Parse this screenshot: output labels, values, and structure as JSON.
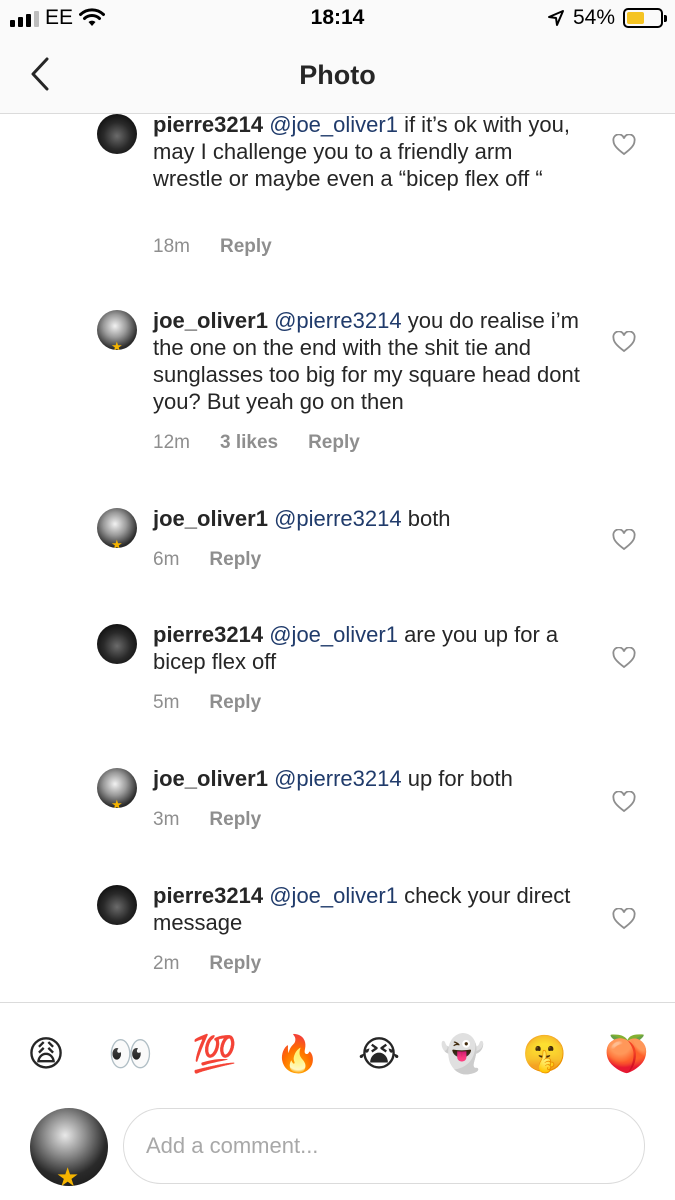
{
  "status_bar": {
    "carrier": "EE",
    "time": "18:14",
    "battery_percent": "54%",
    "battery_level": 0.54,
    "battery_color": "#f5c423"
  },
  "nav": {
    "title": "Photo",
    "back_icon": "chevron-left-icon"
  },
  "comments": [
    {
      "username": "pierre3214",
      "mention": "@joe_oliver1",
      "text": " if it’s ok with you, may I challenge you to a friendly arm wrestle or maybe even a “bicep flex off “",
      "time": "18m",
      "likes": "",
      "reply": "Reply"
    },
    {
      "username": "joe_oliver1",
      "mention": "@pierre3214",
      "text": " you do realise i’m the one on the end with the shit tie and sunglasses too big for my square head dont you? But yeah go on then",
      "time": "12m",
      "likes": "3 likes",
      "reply": "Reply"
    },
    {
      "username": "joe_oliver1",
      "mention": "@pierre3214",
      "text": " both",
      "time": "6m",
      "likes": "",
      "reply": "Reply"
    },
    {
      "username": "pierre3214",
      "mention": "@joe_oliver1",
      "text": " are you up for a bicep flex off",
      "time": "5m",
      "likes": "",
      "reply": "Reply"
    },
    {
      "username": "joe_oliver1",
      "mention": "@pierre3214",
      "text": " up for both",
      "time": "3m",
      "likes": "",
      "reply": "Reply"
    },
    {
      "username": "pierre3214",
      "mention": "@joe_oliver1",
      "text": " check your direct message",
      "time": "2m",
      "likes": "",
      "reply": "Reply"
    }
  ],
  "emoji_bar": [
    {
      "glyph": "😩",
      "name": "weary-face-emoji"
    },
    {
      "glyph": "👀",
      "name": "eyes-emoji"
    },
    {
      "glyph": "💯",
      "name": "hundred-points-emoji"
    },
    {
      "glyph": "🔥",
      "name": "fire-emoji"
    },
    {
      "glyph": "😭",
      "name": "crying-face-emoji"
    },
    {
      "glyph": "👻",
      "name": "ghost-emoji"
    },
    {
      "glyph": "🤫",
      "name": "shushing-face-emoji"
    },
    {
      "glyph": "🍑",
      "name": "peach-emoji"
    }
  ],
  "composer": {
    "placeholder": "Add a comment..."
  }
}
